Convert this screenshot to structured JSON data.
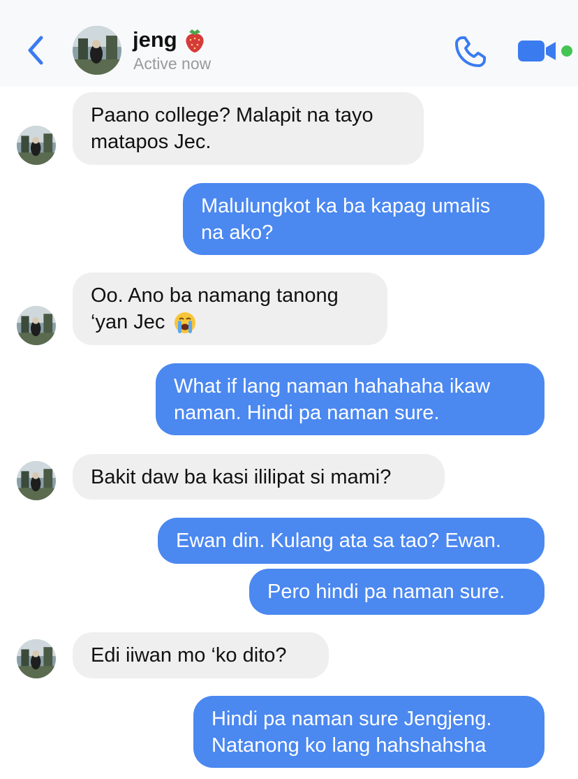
{
  "header": {
    "contact_name": "jeng",
    "name_emoji": "strawberry",
    "status": "Active now",
    "icons": {
      "back": "chevron-left-icon",
      "call": "phone-icon",
      "video": "video-camera-icon"
    },
    "accent_color": "#3a7bf0",
    "online_color": "#44c553"
  },
  "messages": [
    {
      "from": "jeng",
      "line1": "Paano college? Malapit na tayo",
      "line2": "matapos Jec."
    },
    {
      "from": "me",
      "line1": "Malulungkot ka ba kapag umalis",
      "line2": "na ako?"
    },
    {
      "from": "jeng",
      "line1": "Oo. Ano ba namang tanong",
      "line2": "‘yan Jec",
      "emoji": "loudly-crying-face"
    },
    {
      "from": "me",
      "line1": "What if lang naman hahahaha ikaw",
      "line2": "naman. Hindi pa naman sure."
    },
    {
      "from": "jeng",
      "line1": "Bakit daw ba kasi ililipat si mami?"
    },
    {
      "from": "me",
      "line1": "Ewan din. Kulang ata sa tao? Ewan."
    },
    {
      "from": "me",
      "line1": "Pero hindi pa naman sure."
    },
    {
      "from": "jeng",
      "line1": "Edi iiwan mo ‘ko dito?"
    },
    {
      "from": "me",
      "line1": "Hindi pa naman sure Jengjeng.",
      "line2": "Natanong ko lang hahshahsha"
    }
  ],
  "colors": {
    "incoming_bubble": "#efefef",
    "outgoing_bubble": "#4b88f0"
  }
}
